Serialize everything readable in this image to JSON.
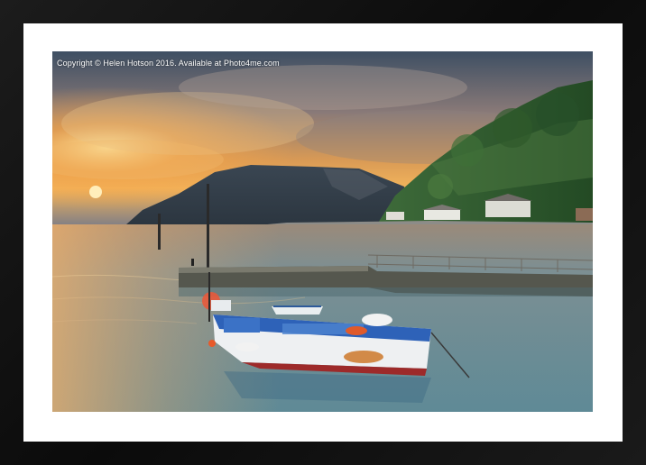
{
  "watermark": {
    "text": "Copyright  © Helen Hotson  2016. Available at Photo4me.com"
  },
  "colors": {
    "frame": "#111111",
    "mount": "#ffffff",
    "sky_glow": "#f4b35a",
    "water": "#6f8d98",
    "hill_green": "#2f5a2a",
    "boat_blue": "#2e62b8"
  }
}
